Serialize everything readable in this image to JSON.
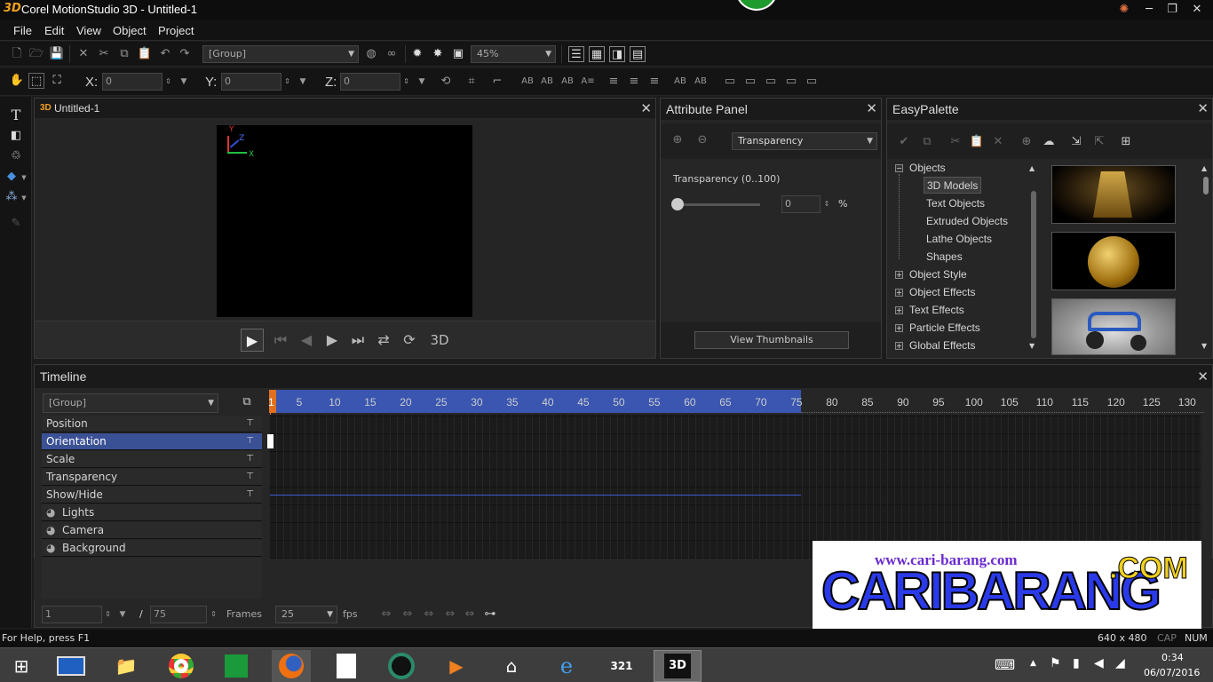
{
  "window": {
    "title": "Corel MotionStudio 3D - Untitled-1",
    "logo": "3D"
  },
  "menu": [
    "File",
    "Edit",
    "View",
    "Object",
    "Project"
  ],
  "toolbar1": {
    "group_combo": "[Group]",
    "zoom_combo": "45%"
  },
  "toolbar2": {
    "x_label": "X:",
    "x_value": "0",
    "y_label": "Y:",
    "y_value": "0",
    "z_label": "Z:",
    "z_value": "0"
  },
  "viewport": {
    "title": "Untitled-1",
    "axis_x": "X",
    "axis_y": "Y",
    "axis_z": "Z",
    "mode_label": "3D"
  },
  "attribute_panel": {
    "title": "Attribute Panel",
    "dropdown": "Transparency",
    "field_label": "Transparency (0..100)",
    "value": "0",
    "unit": "%",
    "slider_fraction": 0.0,
    "thumbnails_button": "View Thumbnails"
  },
  "easy_palette": {
    "title": "EasyPalette",
    "tree": [
      {
        "label": "Objects",
        "expanded": true,
        "children": [
          "3D Models",
          "Text Objects",
          "Extruded Objects",
          "Lathe Objects",
          "Shapes"
        ],
        "selected_child": "3D Models"
      },
      {
        "label": "Object Style"
      },
      {
        "label": "Object Effects"
      },
      {
        "label": "Text Effects"
      },
      {
        "label": "Particle Effects"
      },
      {
        "label": "Global Effects"
      }
    ]
  },
  "timeline": {
    "title": "Timeline",
    "group_combo": "[Group]",
    "tracks": [
      {
        "label": "Position",
        "pin": true
      },
      {
        "label": "Orientation",
        "pin": true,
        "selected": true
      },
      {
        "label": "Scale",
        "pin": true
      },
      {
        "label": "Transparency",
        "pin": true
      },
      {
        "label": "Show/Hide",
        "pin": true
      },
      {
        "label": "Lights",
        "icon": "light-icon"
      },
      {
        "label": "Camera",
        "icon": "camera-icon"
      },
      {
        "label": "Background",
        "icon": "background-icon"
      }
    ],
    "ruler": [
      "1",
      "5",
      "10",
      "15",
      "20",
      "25",
      "30",
      "35",
      "40",
      "45",
      "50",
      "55",
      "60",
      "65",
      "70",
      "75",
      "80",
      "85",
      "90",
      "95",
      "100",
      "105",
      "110",
      "115",
      "120",
      "125",
      "130"
    ],
    "current_frame": "1",
    "slash": "/",
    "total_frames": "75",
    "frames_label": "Frames",
    "fps_value": "25",
    "fps_label": "fps"
  },
  "statusbar": {
    "help": "For Help, press F1",
    "resolution": "640 x 480",
    "cap": "CAP",
    "num": "NUM"
  },
  "taskbar": {
    "time": "0:34",
    "date": "06/07/2016"
  },
  "watermark": {
    "url": "www.cari-barang.com",
    "brand": "CARIBARANG",
    "suffix": ".COM"
  },
  "colors": {
    "selection": "#3b5196",
    "ruler_active": "#3a56b0",
    "accent": "#f0a020"
  }
}
